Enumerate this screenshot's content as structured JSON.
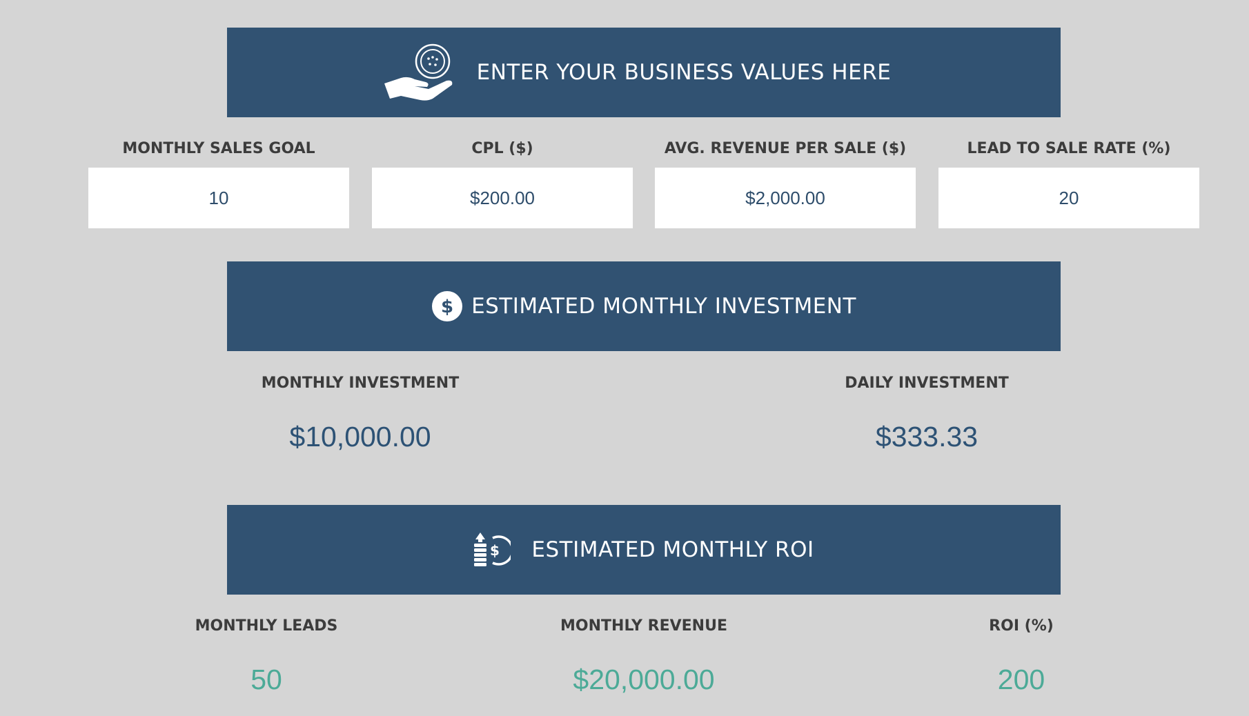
{
  "sections": {
    "inputs": {
      "title": "ENTER YOUR BUSINESS VALUES HERE",
      "icon": "hand-coin-icon"
    },
    "investment": {
      "title": "ESTIMATED MONTHLY INVESTMENT",
      "icon": "dollar-circle-icon"
    },
    "roi": {
      "title": "ESTIMATED MONTHLY ROI",
      "icon": "coin-stack-return-icon"
    }
  },
  "inputs": {
    "monthly_sales_goal": {
      "label": "MONTHLY SALES GOAL",
      "value": "10"
    },
    "cpl": {
      "label": "CPL ($)",
      "value": "$200.00"
    },
    "avg_revenue": {
      "label": "AVG. REVENUE PER SALE ($)",
      "value": "$2,000.00"
    },
    "lead_to_sale_rate": {
      "label": "LEAD TO SALE RATE (%)",
      "value": "20"
    }
  },
  "investment": {
    "monthly": {
      "label": "MONTHLY INVESTMENT",
      "value": "$10,000.00"
    },
    "daily": {
      "label": "DAILY INVESTMENT",
      "value": "$333.33"
    }
  },
  "roi": {
    "monthly_leads": {
      "label": "MONTHLY LEADS",
      "value": "50"
    },
    "monthly_revenue": {
      "label": "MONTHLY REVENUE",
      "value": "$20,000.00"
    },
    "roi_percent": {
      "label": "ROI (%)",
      "value": "200"
    }
  },
  "colors": {
    "background": "#d5d5d5",
    "banner": "#315272",
    "value_blue": "#2d5275",
    "value_green": "#4caa97",
    "label": "#3c3c3c"
  }
}
